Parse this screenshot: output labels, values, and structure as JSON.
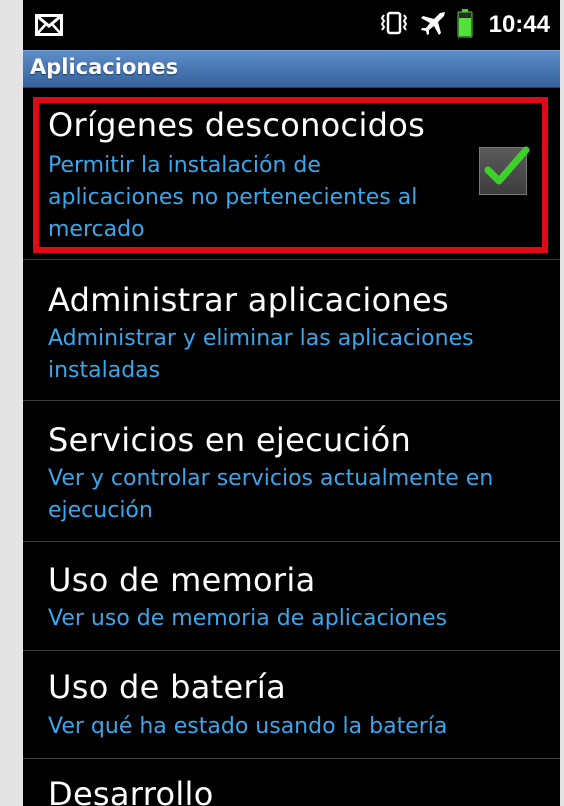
{
  "status_bar": {
    "time": "10:44",
    "icons": [
      "mail-icon",
      "vibrate-icon",
      "airplane-icon",
      "battery-icon"
    ]
  },
  "header": {
    "title": "Aplicaciones"
  },
  "settings": {
    "items": [
      {
        "title": "Orígenes desconocidos",
        "summary": "Permitir la instalación de aplicaciones no pertenecientes al mercado",
        "checked": true
      },
      {
        "title": "Administrar aplicaciones",
        "summary": "Administrar y eliminar las aplicaciones instaladas"
      },
      {
        "title": "Servicios en ejecución",
        "summary": "Ver y controlar servicios actualmente en ejecución"
      },
      {
        "title": "Uso de memoria",
        "summary": "Ver uso de memoria de aplicaciones"
      },
      {
        "title": "Uso de batería",
        "summary": "Ver qué ha estado usando la batería"
      },
      {
        "title": "Desarrollo"
      }
    ]
  },
  "colors": {
    "background": "#000000",
    "header_gradient_top": "#5e8ec8",
    "summary_text": "#3aa6ec",
    "highlight_border": "#e20916",
    "check_green": "#3fcf2a"
  }
}
